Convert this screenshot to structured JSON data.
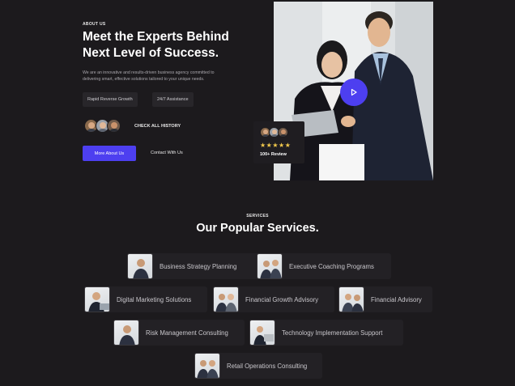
{
  "about": {
    "eyebrow": "ABOUT US",
    "title": "Meet the Experts Behind Next Level of Success.",
    "description": "We are an innovative and results-driven business agency committed to delivering smart, effective solutions tailored to your unique needs.",
    "chips": [
      "Rapid Reverse Growth",
      "24/7 Assistance"
    ],
    "history_link": "CHECK ALL HISTORY",
    "primary_button": "More About Us",
    "secondary_button": "Contact With Us"
  },
  "hero": {
    "play_icon": "play-icon",
    "review": {
      "stars": "★★★★★",
      "rating": 5,
      "label": "100+ Review"
    }
  },
  "services": {
    "eyebrow": "SERVICES",
    "title": "Our Popular Services.",
    "items": [
      "Business Strategy Planning",
      "Executive Coaching Programs",
      "Digital Marketing Solutions",
      "Financial Growth Advisory",
      "Financial Advisory",
      "Risk Management Consulting",
      "Technology Implementation Support",
      "Retail Operations Consulting"
    ]
  },
  "colors": {
    "background": "#1c1a1d",
    "accent": "#4d3ff0",
    "card": "#232125",
    "star": "#f2c94c"
  }
}
